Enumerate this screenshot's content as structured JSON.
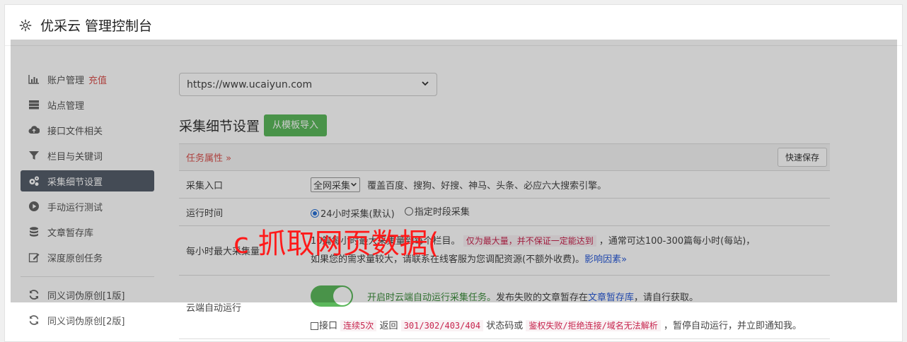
{
  "header": {
    "title": "优采云 管理控制台",
    "icon": "gear-icon"
  },
  "sidebar": {
    "items": [
      {
        "label": "账户管理",
        "badge": "充值",
        "icon": "bar-chart-icon"
      },
      {
        "label": "站点管理",
        "icon": "server-icon"
      },
      {
        "label": "接口文件相关",
        "icon": "cloud-upload-icon"
      },
      {
        "label": "栏目与关键词",
        "icon": "filter-icon"
      },
      {
        "label": "采集细节设置",
        "icon": "cogs-icon",
        "active": true
      },
      {
        "label": "手动运行测试",
        "icon": "play-circle-icon"
      },
      {
        "label": "文章暂存库",
        "icon": "database-icon"
      },
      {
        "label": "深度原创任务",
        "icon": "edit-icon"
      },
      {
        "label": "同义词伪原创[1版]",
        "icon": "refresh-icon"
      },
      {
        "label": "同义词伪原创[2版]",
        "icon": "refresh-icon"
      }
    ]
  },
  "main": {
    "site_select": "https://www.ucaiyun.com",
    "section_title": "采集细节设置",
    "import_button": "从模板导入",
    "task_header": "任务属性 »",
    "quick_save": "快速保存",
    "rows": {
      "entry": {
        "label": "采集入口",
        "select": "全网采集",
        "desc": "覆盖百度、搜狗、好搜、神马、头条、必应六大搜索引擎。"
      },
      "time": {
        "label": "运行时间",
        "option1": "24小时采集(默认)",
        "option2": "指定时段采集"
      },
      "max": {
        "label": "每小时最大采集量",
        "line1_a": "10篇每小时最大采集量到每个栏目。",
        "line1_code": "仅为最大量，并不保证一定能达到",
        "line1_b": "，通常可达100-300篇每小时(每站)，",
        "line2": "如果您的需求量较大，请联系在线客服为您调配资源(不额外收费)。",
        "line2_link": "影响因素»"
      },
      "auto": {
        "label": "云端自动运行",
        "desc_a": "开启时云端自动运行采集任务。",
        "desc_b": "发布失败的文章暂存在",
        "desc_link": "文章暂存库",
        "desc_c": "，请自行获取。",
        "check_label": "接口",
        "code1": "连续5次",
        "mid1": "返回",
        "code2": "301/302/403/404",
        "mid2": "状态码或",
        "code3": "鉴权失败/拒绝连接/域名无法解析",
        "tail": "，暂停自动运行，并立即通知我。"
      }
    }
  },
  "watermark": "c 抓取网页数据(",
  "colors": {
    "accent_green": "#5cb85c",
    "danger_red": "#d9534f",
    "link_blue": "#2a5bd7",
    "active_nav": "#565e6b"
  }
}
